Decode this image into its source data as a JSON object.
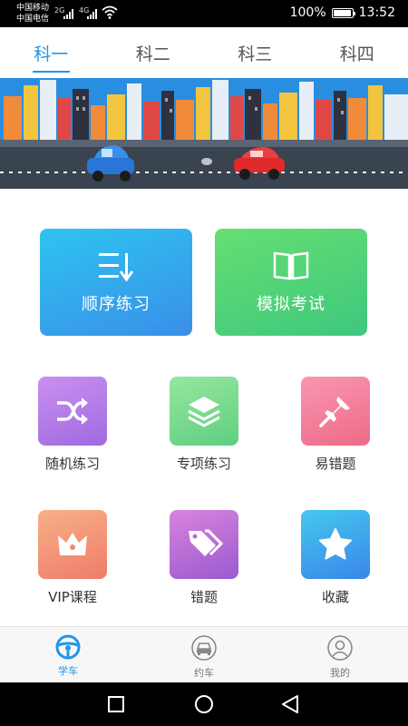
{
  "status_bar": {
    "carrier1": "中国移动",
    "carrier2": "中国电信",
    "net1": "2G",
    "net2": "4G",
    "battery": "100%",
    "time": "13:52"
  },
  "tabs": [
    {
      "label": "科一",
      "active": true
    },
    {
      "label": "科二",
      "active": false
    },
    {
      "label": "科三",
      "active": false
    },
    {
      "label": "科四",
      "active": false
    }
  ],
  "main_cards": [
    {
      "label": "顺序练习",
      "icon": "list-sort-icon"
    },
    {
      "label": "模拟考试",
      "icon": "open-book-icon"
    }
  ],
  "grid": [
    {
      "label": "随机练习",
      "icon": "shuffle-icon"
    },
    {
      "label": "专项练习",
      "icon": "layers-icon"
    },
    {
      "label": "易错题",
      "icon": "pin-icon"
    },
    {
      "label": "VIP课程",
      "icon": "crown-icon"
    },
    {
      "label": "错题",
      "icon": "tags-icon"
    },
    {
      "label": "收藏",
      "icon": "star-icon"
    }
  ],
  "bottom_nav": [
    {
      "label": "学车",
      "icon": "steering-wheel-icon",
      "active": true
    },
    {
      "label": "约车",
      "icon": "car-icon",
      "active": false
    },
    {
      "label": "我的",
      "icon": "user-icon",
      "active": false
    }
  ],
  "colors": {
    "accent": "#2196e8",
    "order_card": "#3aa8ec",
    "exam_card": "#4fd27a",
    "shuffle": "#b57ae8",
    "layers": "#7fd98a",
    "pin": "#f0708e",
    "crown": "#f5906e",
    "tags": "#c06ad0",
    "star": "#3aa0ee"
  }
}
